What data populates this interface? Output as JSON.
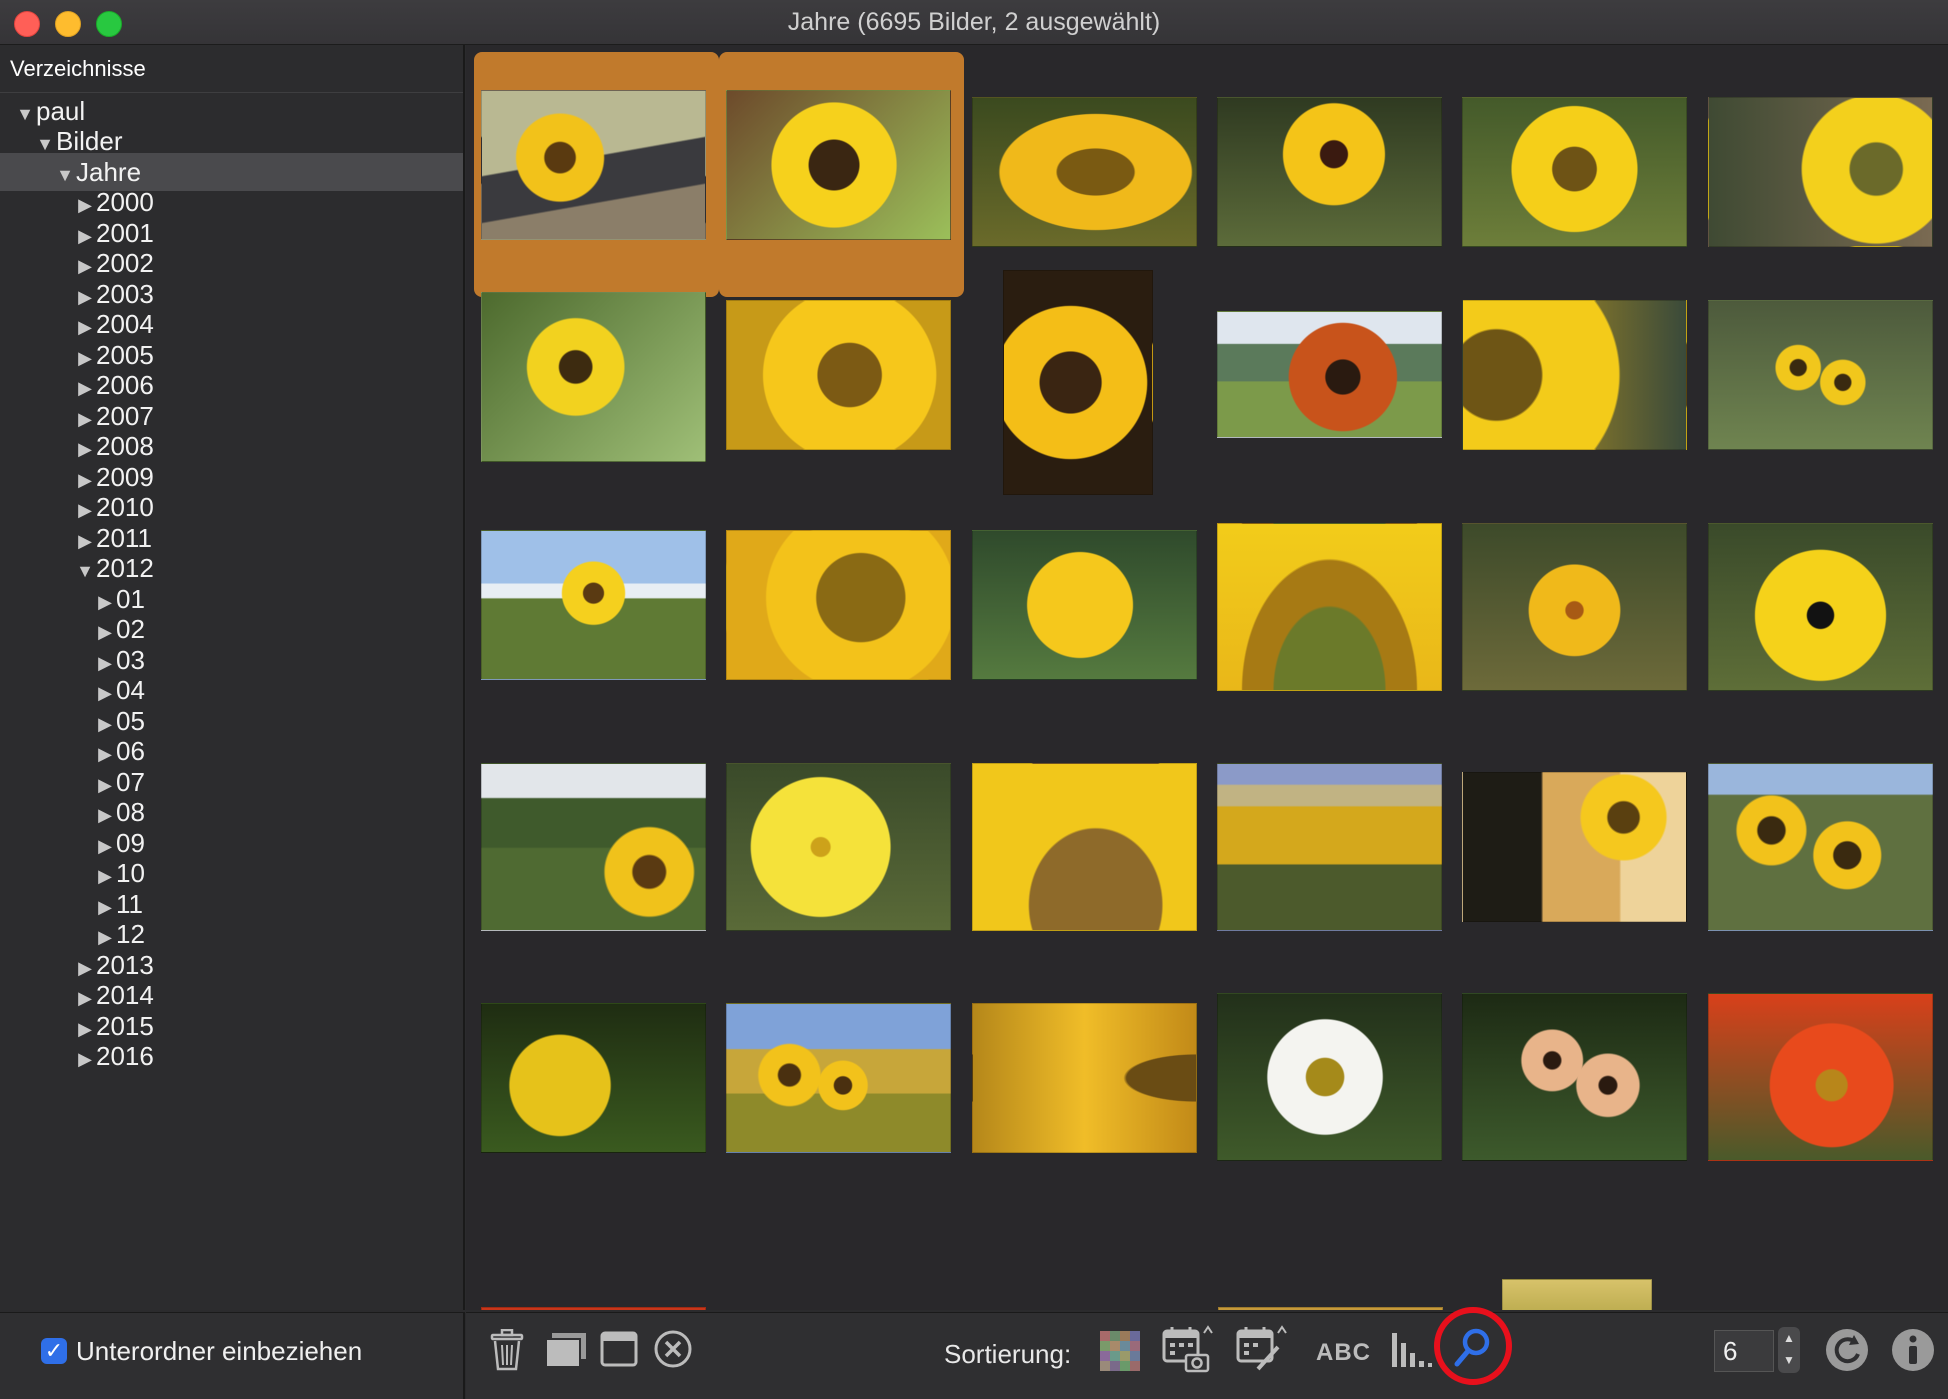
{
  "window": {
    "title": "Jahre (6695 Bilder, 2 ausgewählt)"
  },
  "sidebar": {
    "header": "Verzeichnisse",
    "tree": [
      {
        "label": "paul",
        "expanded": true
      },
      {
        "label": "Bilder",
        "expanded": true
      },
      {
        "label": "Jahre",
        "expanded": true,
        "selected": true
      },
      {
        "label": "2000"
      },
      {
        "label": "2001"
      },
      {
        "label": "2002"
      },
      {
        "label": "2003"
      },
      {
        "label": "2004"
      },
      {
        "label": "2005"
      },
      {
        "label": "2006"
      },
      {
        "label": "2007"
      },
      {
        "label": "2008"
      },
      {
        "label": "2009"
      },
      {
        "label": "2010"
      },
      {
        "label": "2011"
      },
      {
        "label": "2012",
        "expanded": true
      },
      {
        "label": "01"
      },
      {
        "label": "02"
      },
      {
        "label": "03"
      },
      {
        "label": "04"
      },
      {
        "label": "05"
      },
      {
        "label": "06"
      },
      {
        "label": "07"
      },
      {
        "label": "08"
      },
      {
        "label": "09"
      },
      {
        "label": "10"
      },
      {
        "label": "11"
      },
      {
        "label": "12"
      },
      {
        "label": "2013"
      },
      {
        "label": "2014"
      },
      {
        "label": "2015"
      },
      {
        "label": "2016"
      }
    ],
    "footer_checkbox_label": "Unterordner einbeziehen",
    "footer_checkbox_checked": true
  },
  "grid": {
    "columns": 6,
    "selected_count": 2,
    "thumbnails": [
      {
        "subject": "sunflower-on-bench",
        "selected": true
      },
      {
        "subject": "sunflower-closeup",
        "selected": true
      },
      {
        "subject": "sunflower-side"
      },
      {
        "subject": "black-eyed-susan"
      },
      {
        "subject": "sunflower"
      },
      {
        "subject": "sunflower-garden"
      },
      {
        "subject": "sunflower-leaves"
      },
      {
        "subject": "sunflower-macro"
      },
      {
        "subject": "sunflower-portrait"
      },
      {
        "subject": "red-sunflower-lake"
      },
      {
        "subject": "sunflower-half"
      },
      {
        "subject": "sunflowers-garden"
      },
      {
        "subject": "sunflower-field-sky"
      },
      {
        "subject": "sunflower-bee"
      },
      {
        "subject": "yellow-dahlia"
      },
      {
        "subject": "sunflower-bees"
      },
      {
        "subject": "yellow-daisy"
      },
      {
        "subject": "yellow-poppy"
      },
      {
        "subject": "sunflower-field"
      },
      {
        "subject": "yellow-hibiscus"
      },
      {
        "subject": "sunflower-center"
      },
      {
        "subject": "sunflower-field-wide"
      },
      {
        "subject": "sunflower-sunset"
      },
      {
        "subject": "sunflower-field-blue-sky"
      },
      {
        "subject": "dandelion-bee"
      },
      {
        "subject": "sunflowers-blue-sky"
      },
      {
        "subject": "sunflower-bee-petals"
      },
      {
        "subject": "white-coneflower"
      },
      {
        "subject": "peach-daisies"
      },
      {
        "subject": "red-flower-bee"
      }
    ]
  },
  "toolbar": {
    "sort_label": "Sortierung:",
    "abc_label": "ABC",
    "count_value": "6",
    "icons": [
      "trash-icon",
      "stack-icon",
      "window-icon",
      "close-icon",
      "color-grid-icon",
      "calendar-camera-icon",
      "calendar-edit-icon",
      "abc-icon",
      "histogram-icon",
      "search-icon",
      "refresh-icon",
      "info-icon"
    ]
  }
}
